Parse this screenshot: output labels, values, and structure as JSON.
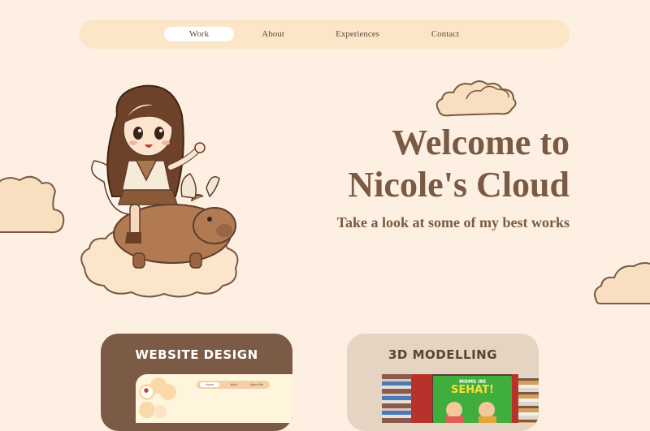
{
  "nav": {
    "items": [
      {
        "label": "Work",
        "active": true
      },
      {
        "label": "About",
        "active": false
      },
      {
        "label": "Experiences",
        "active": false
      },
      {
        "label": "Contact",
        "active": false
      }
    ]
  },
  "hero": {
    "title_line1": "Welcome to",
    "title_line2": "Nicole's Cloud",
    "subtitle": "Take a look at some of my best works",
    "illustration": "girl-riding-winged-capybara-on-cloud"
  },
  "cards": [
    {
      "title": "WEBSITE DESIGN",
      "preview": {
        "nav": [
          "Home",
          "Work",
          "About Me"
        ]
      }
    },
    {
      "title": "3D MODELLING",
      "preview": {
        "banner_top": "MOMS INI",
        "banner_main": "SEHAT!"
      }
    }
  ],
  "colors": {
    "background": "#fdefe1",
    "nav_bg": "#fce6c8",
    "text_brown": "#7a5a44",
    "card_dark": "#7b5b45",
    "card_light": "#e6d4c3",
    "cloud_fill": "#f7dfbf"
  }
}
